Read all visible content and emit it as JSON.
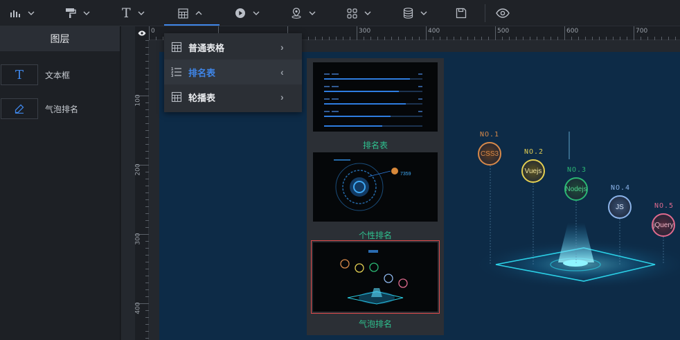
{
  "toolbar": {
    "items": [
      {
        "icon": "bar-chart-icon"
      },
      {
        "icon": "paint-roller-icon"
      },
      {
        "icon": "text-icon",
        "glyph": "T"
      },
      {
        "icon": "table-icon"
      },
      {
        "icon": "media-play-icon"
      },
      {
        "icon": "map-pin-icon"
      },
      {
        "icon": "widgets-icon"
      },
      {
        "icon": "database-icon"
      },
      {
        "icon": "save-icon"
      },
      {
        "icon": "eye-icon"
      }
    ]
  },
  "layer_panel": {
    "title": "图层",
    "items": [
      {
        "label": "文本框",
        "icon": "text-icon",
        "glyph": "T"
      },
      {
        "label": "气泡排名",
        "icon": "pen-icon"
      }
    ]
  },
  "ruler": {
    "top": [
      "0",
      "300",
      "400",
      "500",
      "600",
      "700"
    ],
    "left": [
      "100",
      "200",
      "300",
      "400"
    ]
  },
  "chart_menu": {
    "items": [
      {
        "label": "普通表格",
        "arrow": "›"
      },
      {
        "label": "排名表",
        "arrow": "‹"
      },
      {
        "label": "轮播表",
        "arrow": "›"
      }
    ]
  },
  "sub_panel": {
    "thumbs": [
      {
        "label": "排名表"
      },
      {
        "label": "个性排名"
      },
      {
        "label": "气泡排名"
      }
    ],
    "thumb2_text": "7359"
  },
  "bubble_chart": {
    "items": [
      {
        "rank": "NO.1",
        "name": "CSS3",
        "color": "#d7894a"
      },
      {
        "rank": "NO.2",
        "name": "Vuejs",
        "color": "#e3cf52"
      },
      {
        "rank": "NO.3",
        "name": "Nodejs",
        "color": "#2bb673"
      },
      {
        "rank": "NO.4",
        "name": "JS",
        "color": "#8cb4ea"
      },
      {
        "rank": "NO.5",
        "name": "jQuery",
        "color": "#e06a8e"
      }
    ]
  }
}
